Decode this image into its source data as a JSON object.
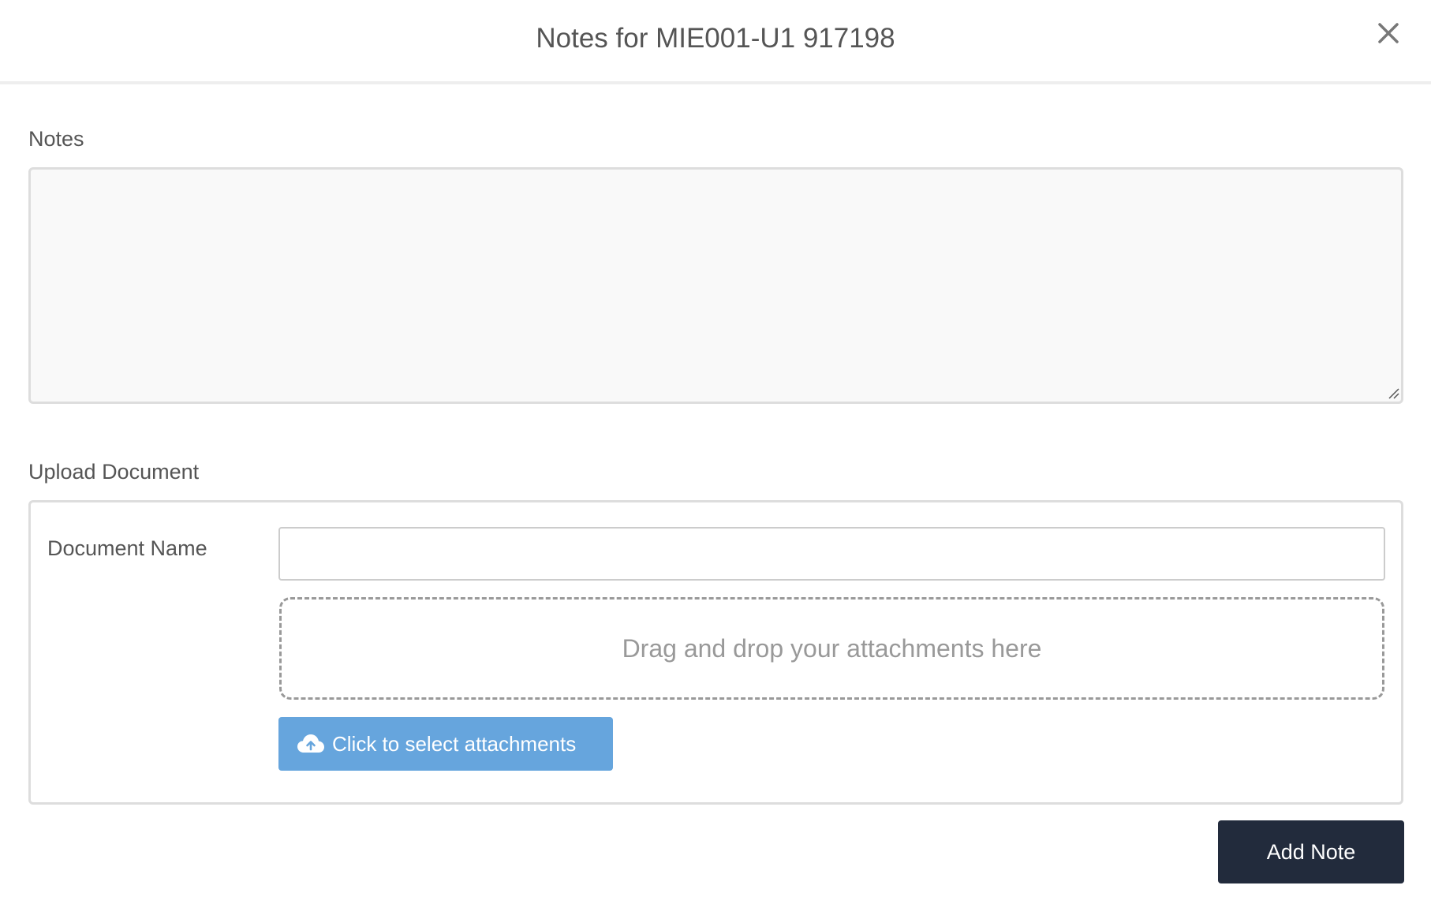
{
  "modal": {
    "title": "Notes for MIE001-U1 917198",
    "close_icon": "close-icon"
  },
  "notes": {
    "label": "Notes",
    "value": "",
    "placeholder": ""
  },
  "upload": {
    "label": "Upload Document",
    "document_name_label": "Document Name",
    "document_name_value": "",
    "dropzone_text": "Drag and drop your attachments here",
    "attach_button_label": "Click to select attachments",
    "attach_icon": "cloud-upload-icon",
    "attach_button_color": "#66a5dd"
  },
  "footer": {
    "add_note_label": "Add Note",
    "add_note_color": "#222b3c"
  }
}
